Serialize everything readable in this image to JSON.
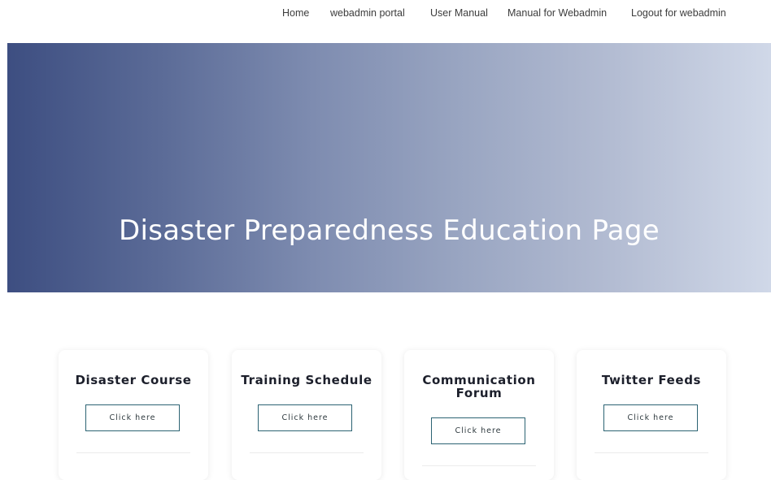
{
  "nav": {
    "items": [
      {
        "label": "Home"
      },
      {
        "label": "webadmin portal"
      },
      {
        "label": "User Manual"
      },
      {
        "label": "Manual for Webadmin"
      },
      {
        "label": "Logout for webadmin"
      }
    ]
  },
  "hero": {
    "title": "Disaster Preparedness Education Page"
  },
  "cards": [
    {
      "title": "Disaster Course",
      "button_label": "Click here"
    },
    {
      "title": "Training Schedule",
      "button_label": "Click here"
    },
    {
      "title": "Communication Forum",
      "button_label": "Click here"
    },
    {
      "title": "Twitter Feeds",
      "button_label": "Click here"
    }
  ],
  "colors": {
    "hero_gradient_start": "#3d4e81",
    "hero_gradient_end": "#d0d8e8",
    "button_border": "#2c6373",
    "card_title": "#1c1f2b"
  }
}
